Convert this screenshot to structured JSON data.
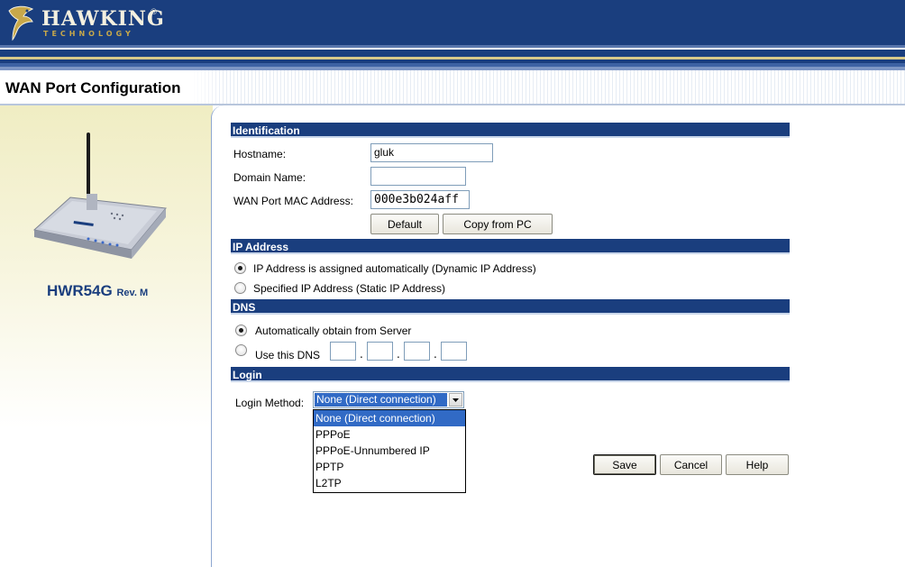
{
  "brand": {
    "name": "HAWKING",
    "registered": "®",
    "subtitle": "TECHNOLOGY"
  },
  "page_title": "WAN Port Configuration",
  "product": {
    "model": "HWR54G",
    "revision": "Rev. M"
  },
  "sections": {
    "identification": "Identification",
    "ip_address": "IP Address",
    "dns": "DNS",
    "login": "Login"
  },
  "identification": {
    "hostname_label": "Hostname:",
    "hostname_value": "gluk",
    "domain_label": "Domain Name:",
    "domain_value": "",
    "mac_label": "WAN Port MAC Address:",
    "mac_value": "000e3b024aff",
    "default_button": "Default",
    "copy_button": "Copy from PC"
  },
  "ip_address": {
    "dynamic_label": "IP Address is assigned automatically (Dynamic IP Address)",
    "dynamic_selected": true,
    "static_label": "Specified IP Address (Static IP Address)",
    "static_selected": false
  },
  "dns": {
    "auto_label": "Automatically obtain from Server",
    "auto_selected": true,
    "manual_label": "Use this DNS",
    "manual_selected": false,
    "octets": [
      "",
      "",
      "",
      ""
    ],
    "separator": "."
  },
  "login": {
    "method_label": "Login Method:",
    "selected": "None (Direct connection)",
    "options": [
      "None (Direct connection)",
      "PPPoE",
      "PPPoE-Unnumbered IP",
      "PPTP",
      "L2TP"
    ]
  },
  "actions": {
    "save": "Save",
    "cancel": "Cancel",
    "help": "Help"
  },
  "colors": {
    "header": "#1a3e7e",
    "section_bar": "#1a3e7e",
    "selection": "#316ac5",
    "product_text": "#1a3e7e"
  }
}
